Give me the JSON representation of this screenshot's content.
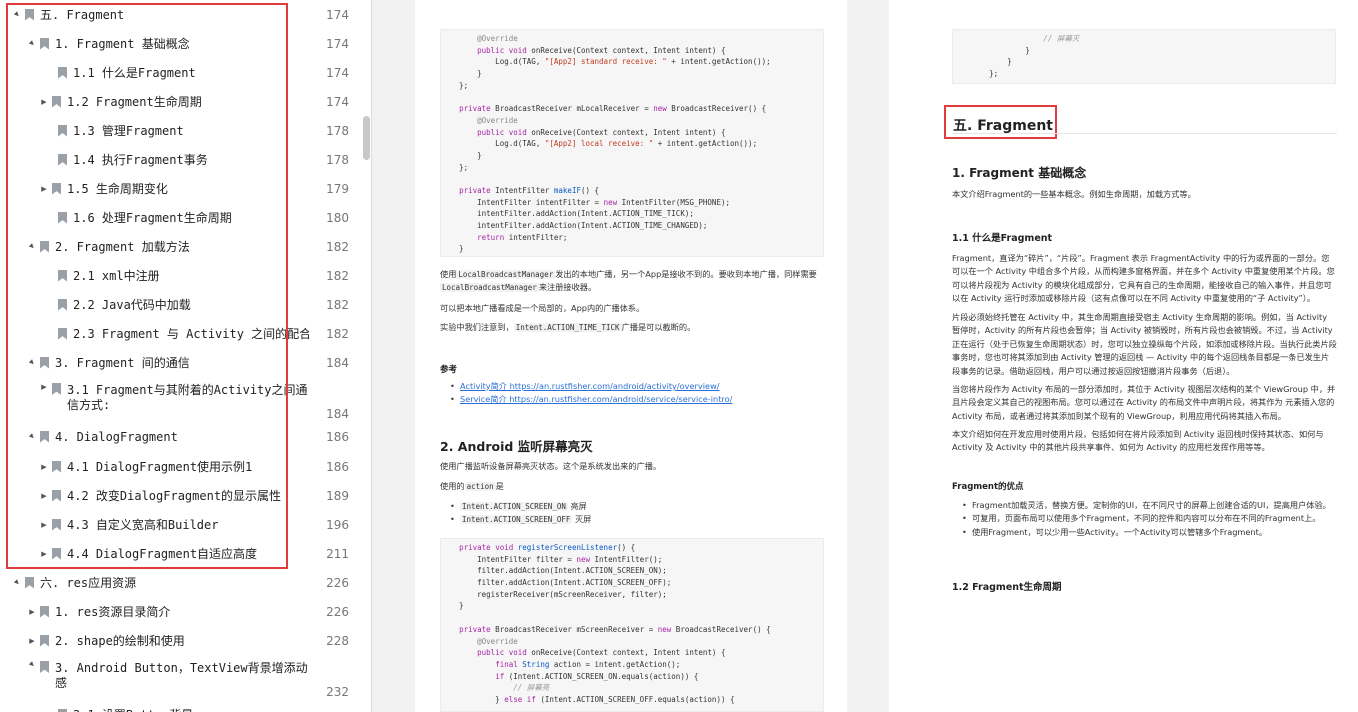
{
  "outline": {
    "items": [
      {
        "arrow": "▲",
        "label": "五. Fragment",
        "page": "174"
      },
      {
        "arrow": "▲",
        "label": "1. Fragment 基础概念",
        "page": "174"
      },
      {
        "arrow": "",
        "label": "1.1 什么是Fragment",
        "page": "174"
      },
      {
        "arrow": "▶",
        "label": "1.2 Fragment生命周期",
        "page": "174"
      },
      {
        "arrow": "",
        "label": "1.3 管理Fragment",
        "page": "178"
      },
      {
        "arrow": "",
        "label": "1.4 执行Fragment事务",
        "page": "178"
      },
      {
        "arrow": "▶",
        "label": "1.5 生命周期变化",
        "page": "179"
      },
      {
        "arrow": "",
        "label": "1.6 处理Fragment生命周期",
        "page": "180"
      },
      {
        "arrow": "▲",
        "label": "2. Fragment 加载方法",
        "page": "182"
      },
      {
        "arrow": "",
        "label": "2.1 xml中注册",
        "page": "182"
      },
      {
        "arrow": "",
        "label": "2.2 Java代码中加载",
        "page": "182"
      },
      {
        "arrow": "",
        "label": "2.3 Fragment 与 Activity 之间的配合",
        "page": "182"
      },
      {
        "arrow": "▲",
        "label": "3. Fragment 间的通信",
        "page": "184"
      },
      {
        "arrow": "▶",
        "label": "3.1 Fragment与其附着的Activity之间通信方式:",
        "page": "184"
      },
      {
        "arrow": "▲",
        "label": "4. DialogFragment",
        "page": "186"
      },
      {
        "arrow": "▶",
        "label": "4.1 DialogFragment使用示例1",
        "page": "186"
      },
      {
        "arrow": "▶",
        "label": "4.2 改变DialogFragment的显示属性",
        "page": "189"
      },
      {
        "arrow": "▶",
        "label": "4.3 自定义宽高和Builder",
        "page": "196"
      },
      {
        "arrow": "▶",
        "label": "4.4 DialogFragment自适应高度",
        "page": "211"
      },
      {
        "arrow": "▲",
        "label": "六. res应用资源",
        "page": "226"
      },
      {
        "arrow": "▶",
        "label": "1. res资源目录简介",
        "page": "226"
      },
      {
        "arrow": "▶",
        "label": "2. shape的绘制和使用",
        "page": "228"
      },
      {
        "arrow": "▲",
        "label": "3. Android Button，TextView背景增添动感",
        "page": "232"
      },
      {
        "arrow": "",
        "label": "3.1 设置Button背景",
        "page": ""
      }
    ]
  },
  "page1": {
    "code1": [
      "        @Override",
      "        public void onReceive(Context context, Intent intent) {",
      "            Log.d(TAG, \"[App2] standard receive: \" + intent.getAction());",
      "        }",
      "    };",
      "",
      "    private BroadcastReceiver mLocalReceiver = new BroadcastReceiver() {",
      "        @Override",
      "        public void onReceive(Context context, Intent intent) {",
      "            Log.d(TAG, \"[App2] local receive: \" + intent.getAction());",
      "        }",
      "    };",
      "",
      "    private IntentFilter makeIF() {",
      "        IntentFilter intentFilter = new IntentFilter(MSG_PHONE);",
      "        intentFilter.addAction(Intent.ACTION_TIME_TICK);",
      "        intentFilter.addAction(Intent.ACTION_TIME_CHANGED);",
      "        return intentFilter;",
      "    }"
    ],
    "para1_pre": "使用",
    "para1_code": "LocalBroadcastManager",
    "para1_mid": "发出的本地广播，另一个App是接收不到的。要收到本地广播，同样需要",
    "para1_code2": "LocalBroadcastManager",
    "para1_post": "来注册接收器。",
    "para2": "可以把本地广播看成是一个局部的，App内的广播体系。",
    "para3_pre": "实验中我们注意到，",
    "para3_code": "Intent.ACTION_TIME_TICK",
    "para3_post": "广播是可以截断的。",
    "ref_heading": "参考",
    "refs": [
      "Activity简介 https://an.rustfisher.com/android/activity/overview/",
      "Service简介 https://an.rustfisher.com/android/service/service-intro/"
    ],
    "h2_android": "2. Android 监听屏幕亮灭",
    "para4": "使用广播监听设备屏幕亮灭状态。这个是系统发出来的广播。",
    "para5_pre": "使用的",
    "para5_code": "action",
    "para5_post": "是",
    "actions": [
      {
        "code": "Intent.ACTION_SCREEN_ON",
        "text": " 亮屏"
      },
      {
        "code": "Intent.ACTION_SCREEN_OFF",
        "text": " 灭屏"
      }
    ],
    "code2": [
      "    private void registerScreenListener() {",
      "        IntentFilter filter = new IntentFilter();",
      "        filter.addAction(Intent.ACTION_SCREEN_ON);",
      "        filter.addAction(Intent.ACTION_SCREEN_OFF);",
      "        registerReceiver(mScreenReceiver, filter);",
      "    }",
      "",
      "    private BroadcastReceiver mScreenReceiver = new BroadcastReceiver() {",
      "        @Override",
      "        public void onReceive(Context context, Intent intent) {",
      "            final String action = intent.getAction();",
      "            if (Intent.ACTION_SCREEN_ON.equals(action)) {",
      "                // 屏幕亮",
      "            } else if (Intent.ACTION_SCREEN_OFF.equals(action)) {"
    ]
  },
  "page2": {
    "code_top": [
      "                    // 屏幕灭",
      "                }",
      "            }",
      "        };"
    ],
    "h1": "五. Fragment",
    "h2_basic": "1. Fragment 基础概念",
    "intro": "本文介绍Fragment的一些基本概念。例如生命周期，加载方式等。",
    "h3_what": "1.1 什么是Fragment",
    "p1": "Fragment，直译为“碎片”，“片段”。Fragment 表示 FragmentActivity 中的行为或界面的一部分。您可以在一个 Activity 中组合多个片段，从而构建多窗格界面，并在多个 Activity 中重复使用某个片段。您可以将片段视为 Activity 的模块化组成部分，它具有自己的生命周期，能接收自己的输入事件，并且您可以在 Activity 运行时添加或移除片段（这有点像可以在不同 Activity 中重复使用的“子 Activity”）。",
    "p2": "片段必须始终托管在 Activity 中，其生命周期直接受宿主 Activity 生命周期的影响。例如，当 Activity 暂停时，Activity 的所有片段也会暂停；当 Activity 被销毁时，所有片段也会被销毁。不过，当 Activity 正在运行（处于已恢复生命周期状态）时，您可以独立操纵每个片段，如添加或移除片段。当执行此类片段事务时，您也可将其添加到由 Activity 管理的返回栈 — Activity 中的每个返回栈条目都是一条已发生片段事务的记录。借助返回栈，用户可以通过按返回按钮撤消片段事务（后退）。",
    "p3": "当您将片段作为 Activity 布局的一部分添加时，其位于 Activity 视图层次结构的某个 ViewGroup 中，并且片段会定义其自己的视图布局。您可以通过在 Activity 的布局文件中声明片段，将其作为 元素插入您的 Activity 布局，或者通过将其添加到某个现有的 ViewGroup，利用应用代码将其插入布局。",
    "p4": "本文介绍如何在开发应用时使用片段，包括如何在将片段添加到 Activity 返回栈时保持其状态、如何与 Activity 及 Activity 中的其他片段共享事件、如何为 Activity 的应用栏发挥作用等等。",
    "h5_adv": "Fragment的优点",
    "advantages": [
      "Fragment加载灵活，替换方便。定制你的UI，在不同尺寸的屏幕上创建合适的UI，提高用户体验。",
      "可复用，页面布局可以使用多个Fragment，不同的控件和内容可以分布在不同的Fragment上。",
      "使用Fragment，可以少用一些Activity。一个Activity可以管辖多个Fragment。"
    ],
    "h4_life": "1.2 Fragment生命周期"
  },
  "colors": {
    "highlight": "#e03c3c",
    "link": "#2a6fd6",
    "keyword": "#a626a4",
    "string": "#c23b22"
  }
}
